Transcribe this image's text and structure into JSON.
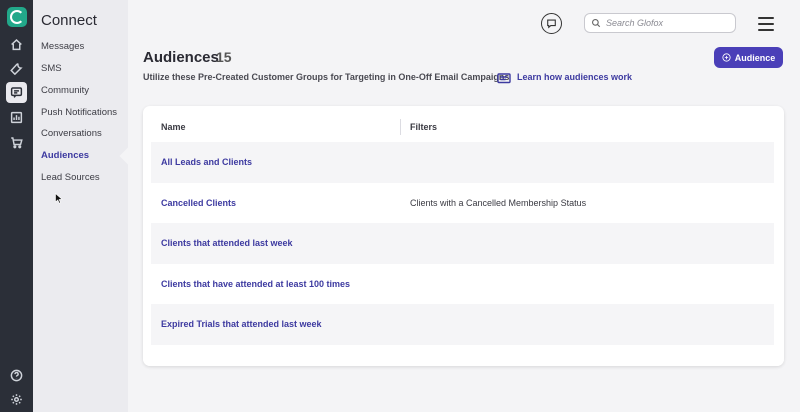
{
  "rail": {
    "icons": [
      "home-icon",
      "wrench-icon",
      "message-square-icon",
      "bar-chart-icon",
      "cart-icon"
    ],
    "bottom_icons": [
      "help-icon",
      "gear-icon"
    ]
  },
  "sidebar": {
    "title": "Connect",
    "items": [
      {
        "label": "Messages"
      },
      {
        "label": "SMS"
      },
      {
        "label": "Community"
      },
      {
        "label": "Push Notifications"
      },
      {
        "label": "Conversations"
      },
      {
        "label": "Audiences",
        "active": true
      },
      {
        "label": "Lead Sources"
      }
    ]
  },
  "header": {
    "search_placeholder": "Search Glofox"
  },
  "page": {
    "title": "Audiences",
    "count": "15",
    "subtitle": "Utilize these Pre-Created Customer Groups for Targeting in One-Off Email Campaigns",
    "learn_link": "Learn how audiences work",
    "add_button": "Audience"
  },
  "table": {
    "columns": [
      "Name",
      "Filters"
    ],
    "rows": [
      {
        "name": "All Leads and Clients",
        "filter": ""
      },
      {
        "name": "Cancelled Clients",
        "filter": "Clients with a Cancelled Membership Status"
      },
      {
        "name": "Clients that attended last week",
        "filter": ""
      },
      {
        "name": "Clients that have attended at least 100 times",
        "filter": ""
      },
      {
        "name": "Expired Trials that attended last week",
        "filter": ""
      }
    ]
  },
  "colors": {
    "accent": "#4a3fb8",
    "link": "#3d3aa0",
    "rail_bg": "#2b2f38",
    "logo": "#22a88a"
  }
}
